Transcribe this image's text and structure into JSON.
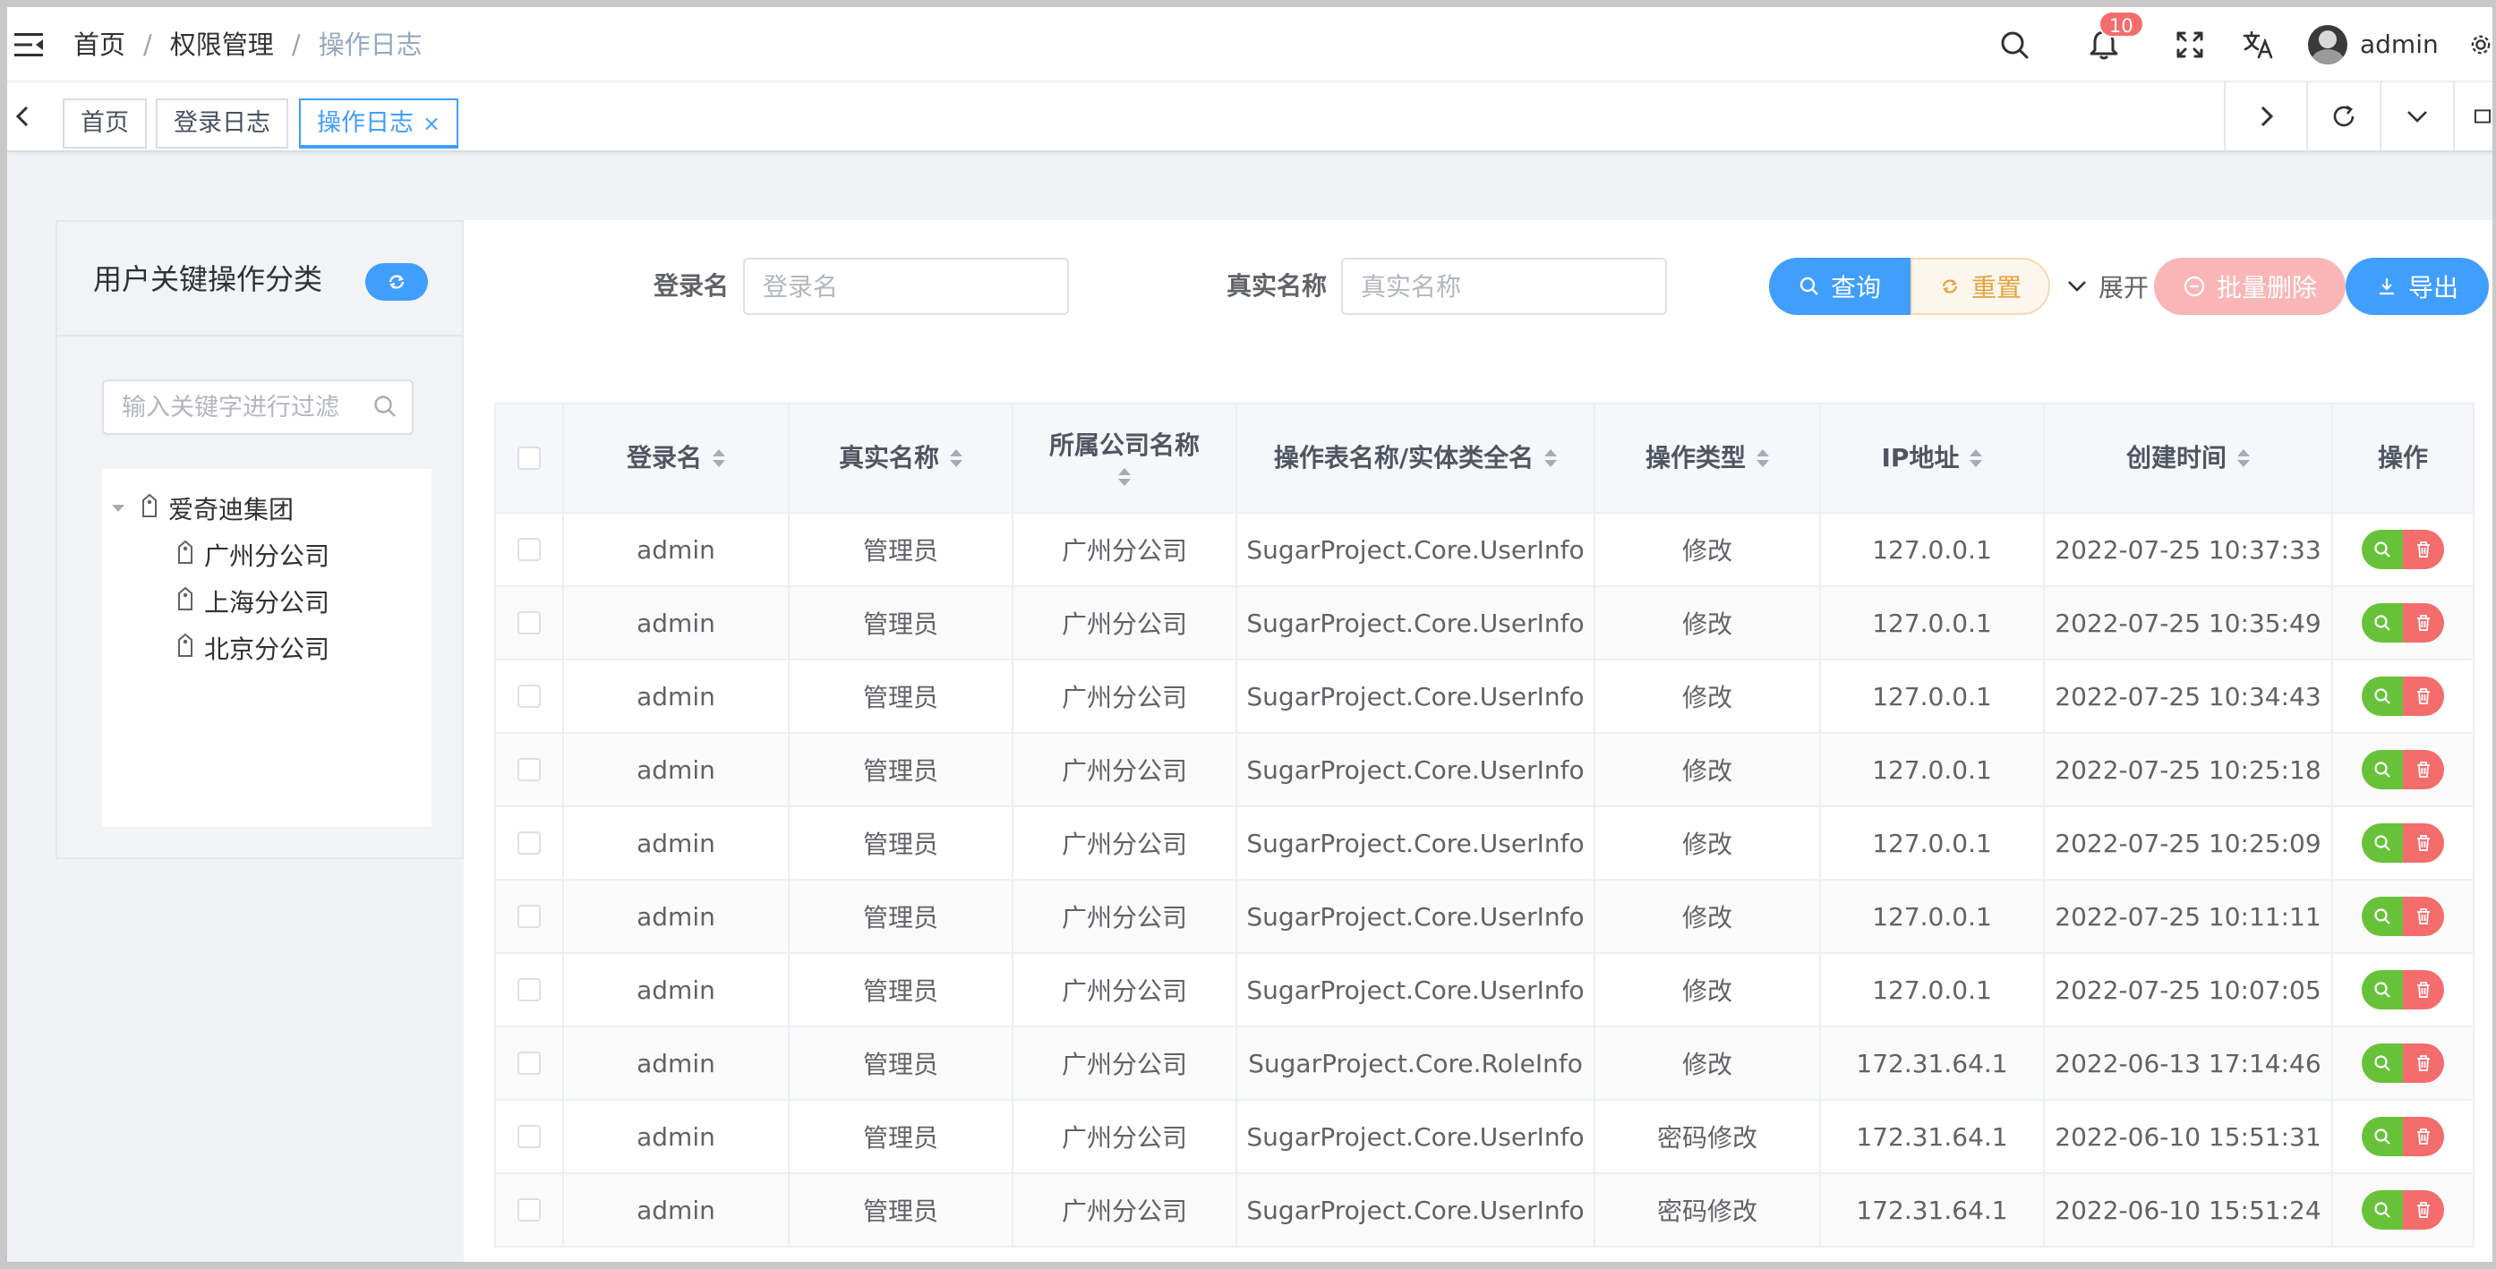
{
  "header": {
    "breadcrumb": [
      "首页",
      "权限管理",
      "操作日志"
    ],
    "separator": "/",
    "notification_count": "10",
    "username": "admin"
  },
  "tags": [
    {
      "label": "首页"
    },
    {
      "label": "登录日志"
    },
    {
      "label": "操作日志",
      "close": "×"
    }
  ],
  "sidebar": {
    "title": "用户关键操作分类",
    "search_placeholder": "输入关键字进行过滤",
    "tree": {
      "root": "爱奇迪集团",
      "children": [
        "广州分公司",
        "上海分公司",
        "北京分公司"
      ]
    }
  },
  "search_form": {
    "login_label": "登录名",
    "login_placeholder": "登录名",
    "realname_label": "真实名称",
    "realname_placeholder": "真实名称",
    "query_label": "查询",
    "reset_label": "重置",
    "expand_label": "展开",
    "batch_delete_label": "批量删除",
    "export_label": "导出"
  },
  "table": {
    "columns": [
      "登录名",
      "真实名称",
      "所属公司名称",
      "操作表名称/实体类全名",
      "操作类型",
      "IP地址",
      "创建时间",
      "操作"
    ],
    "rows": [
      [
        "admin",
        "管理员",
        "广州分公司",
        "SugarProject.Core.UserInfo",
        "修改",
        "127.0.0.1",
        "2022-07-25 10:37:33"
      ],
      [
        "admin",
        "管理员",
        "广州分公司",
        "SugarProject.Core.UserInfo",
        "修改",
        "127.0.0.1",
        "2022-07-25 10:35:49"
      ],
      [
        "admin",
        "管理员",
        "广州分公司",
        "SugarProject.Core.UserInfo",
        "修改",
        "127.0.0.1",
        "2022-07-25 10:34:43"
      ],
      [
        "admin",
        "管理员",
        "广州分公司",
        "SugarProject.Core.UserInfo",
        "修改",
        "127.0.0.1",
        "2022-07-25 10:25:18"
      ],
      [
        "admin",
        "管理员",
        "广州分公司",
        "SugarProject.Core.UserInfo",
        "修改",
        "127.0.0.1",
        "2022-07-25 10:25:09"
      ],
      [
        "admin",
        "管理员",
        "广州分公司",
        "SugarProject.Core.UserInfo",
        "修改",
        "127.0.0.1",
        "2022-07-25 10:11:11"
      ],
      [
        "admin",
        "管理员",
        "广州分公司",
        "SugarProject.Core.UserInfo",
        "修改",
        "127.0.0.1",
        "2022-07-25 10:07:05"
      ],
      [
        "admin",
        "管理员",
        "广州分公司",
        "SugarProject.Core.RoleInfo",
        "修改",
        "172.31.64.1",
        "2022-06-13 17:14:46"
      ],
      [
        "admin",
        "管理员",
        "广州分公司",
        "SugarProject.Core.UserInfo",
        "密码修改",
        "172.31.64.1",
        "2022-06-10 15:51:31"
      ],
      [
        "admin",
        "管理员",
        "广州分公司",
        "SugarProject.Core.UserInfo",
        "密码修改",
        "172.31.64.1",
        "2022-06-10 15:51:24"
      ]
    ]
  },
  "colors": {
    "primary": "#409eff",
    "warning": "#e6a23c",
    "success": "#67c23a",
    "danger": "#f56c6c"
  }
}
